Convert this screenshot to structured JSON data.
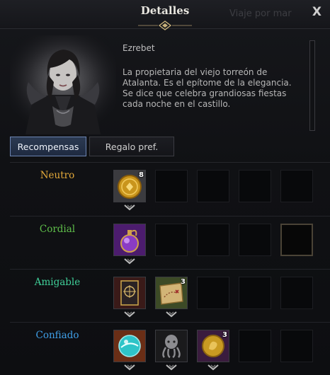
{
  "window": {
    "title": "Detalles",
    "ghost_text": "Viaje por mar",
    "close_label": "X"
  },
  "npc": {
    "name": "Ezrebet",
    "description": "La propietaria del viejo torreón de Atalanta. Es el epítome de la elegancia. Se dice que celebra grandiosas fiestas cada noche en el castillo."
  },
  "tabs": [
    {
      "label": "Recompensas",
      "active": true
    },
    {
      "label": "Regalo pref.",
      "active": false
    }
  ],
  "tiers": [
    {
      "label": "Neutro",
      "color": "#e3a93a",
      "slots": [
        {
          "icon": "gold-coin-icon",
          "count": "8"
        },
        null,
        null,
        null,
        null
      ]
    },
    {
      "label": "Cordial",
      "color": "#5fbf4a",
      "slots": [
        {
          "icon": "purple-potion-icon",
          "count": ""
        },
        null,
        null,
        null,
        {
          "icon": "empty-highlight",
          "count": ""
        }
      ]
    },
    {
      "label": "Amigable",
      "color": "#3fcf98",
      "slots": [
        {
          "icon": "card-icon",
          "count": ""
        },
        {
          "icon": "treasure-map-icon",
          "count": "3"
        },
        null,
        null,
        null
      ]
    },
    {
      "label": "Confiado",
      "color": "#3f9fe8",
      "slots": [
        {
          "icon": "crystal-orb-icon",
          "count": ""
        },
        {
          "icon": "octopus-statue-icon",
          "count": ""
        },
        {
          "icon": "golden-coin-icon",
          "count": "3"
        },
        null,
        null
      ]
    }
  ]
}
